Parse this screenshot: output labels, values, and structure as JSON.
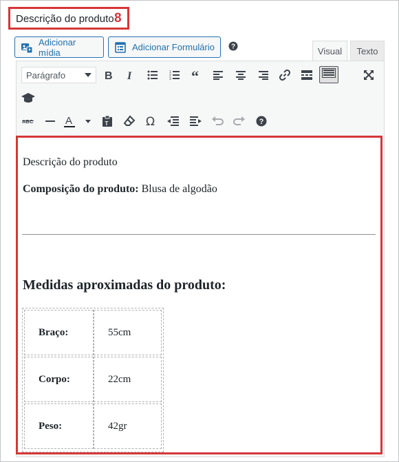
{
  "section": {
    "title": "Descrição do produto",
    "marker": "8"
  },
  "media_buttons": {
    "add_media": "Adicionar mídia",
    "add_form": "Adicionar Formulário"
  },
  "tabs": {
    "visual": "Visual",
    "text": "Texto"
  },
  "toolbar": {
    "format_select": "Parágrafo"
  },
  "content": {
    "line1": "Descrição do produto",
    "composition_label": "Composição do produto:",
    "composition_value": " Blusa de algodão",
    "heading": "Medidas aproximadas do produto:",
    "table": [
      {
        "label": "Braço:",
        "value": "55cm"
      },
      {
        "label": "Corpo:",
        "value": "22cm"
      },
      {
        "label": "Peso:",
        "value": "42gr"
      }
    ]
  },
  "colors": {
    "highlight": "#d63638",
    "accent": "#2271b1"
  }
}
